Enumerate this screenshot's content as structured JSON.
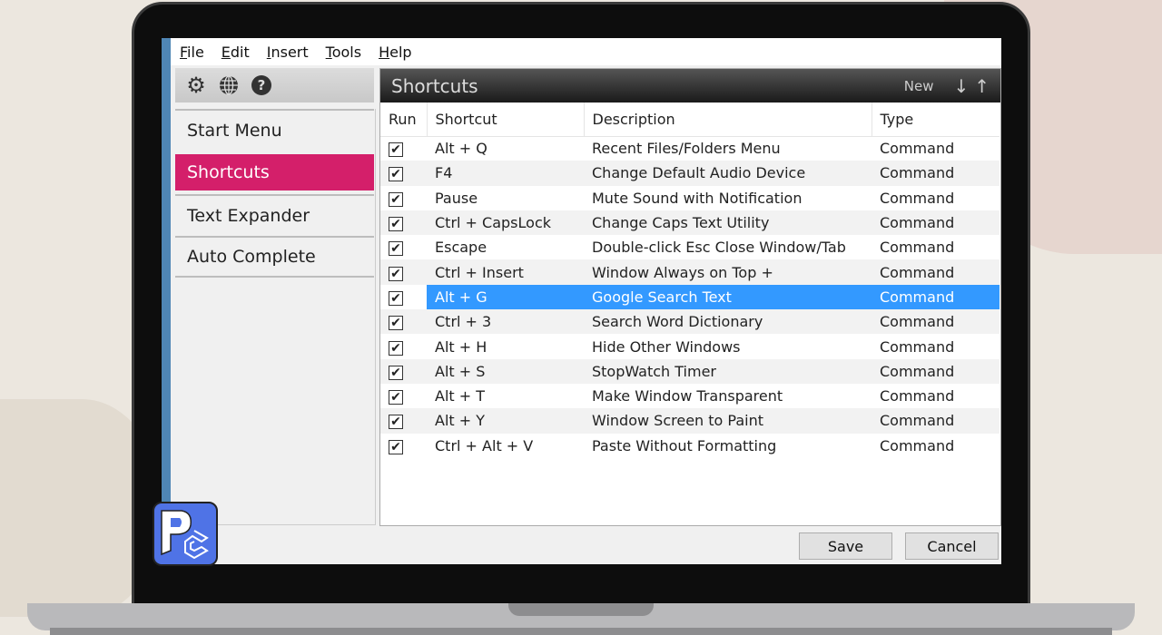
{
  "menu": [
    "File",
    "Edit",
    "Insert",
    "Tools",
    "Help"
  ],
  "toolbar_icons": [
    "gear-icon",
    "globe-icon",
    "help-icon"
  ],
  "sidebar": [
    {
      "label": "Start Menu"
    },
    {
      "label": "Shortcuts",
      "active": true
    },
    {
      "label": "Text Expander"
    },
    {
      "label": "Auto Complete"
    }
  ],
  "panel": {
    "title": "Shortcuts",
    "new_label": "New",
    "down": "↓",
    "up": "↑"
  },
  "columns": [
    "Run",
    "Shortcut",
    "Description",
    "Type"
  ],
  "rows": [
    {
      "run": true,
      "shortcut": "Alt + Q",
      "description": "Recent Files/Folders Menu",
      "type": "Command"
    },
    {
      "run": true,
      "shortcut": "F4",
      "description": "Change Default Audio Device",
      "type": "Command"
    },
    {
      "run": true,
      "shortcut": "Pause",
      "description": "Mute Sound with Notification",
      "type": "Command"
    },
    {
      "run": true,
      "shortcut": "Ctrl + CapsLock",
      "description": "Change Caps Text Utility",
      "type": "Command"
    },
    {
      "run": true,
      "shortcut": "Escape",
      "description": "Double-click Esc Close Window/Tab",
      "type": "Command"
    },
    {
      "run": true,
      "shortcut": "Ctrl + Insert",
      "description": "Window Always on Top +",
      "type": "Command"
    },
    {
      "run": true,
      "shortcut": "Alt + G",
      "description": "Google Search Text",
      "type": "Command",
      "selected": true
    },
    {
      "run": true,
      "shortcut": "Ctrl + 3",
      "description": "Search Word Dictionary",
      "type": "Command"
    },
    {
      "run": true,
      "shortcut": "Alt + H",
      "description": "Hide Other Windows",
      "type": "Command"
    },
    {
      "run": true,
      "shortcut": "Alt + S",
      "description": "StopWatch Timer",
      "type": "Command"
    },
    {
      "run": true,
      "shortcut": "Alt + T",
      "description": "Make Window Transparent",
      "type": "Command"
    },
    {
      "run": true,
      "shortcut": "Alt + Y",
      "description": "Window Screen to Paint",
      "type": "Command"
    },
    {
      "run": true,
      "shortcut": "Ctrl + Alt + V",
      "description": "Paste Without Formatting",
      "type": "Command"
    }
  ],
  "buttons": {
    "save": "Save",
    "cancel": "Cancel"
  },
  "colors": {
    "accent": "#d41f6a",
    "selection": "#3399ff"
  }
}
